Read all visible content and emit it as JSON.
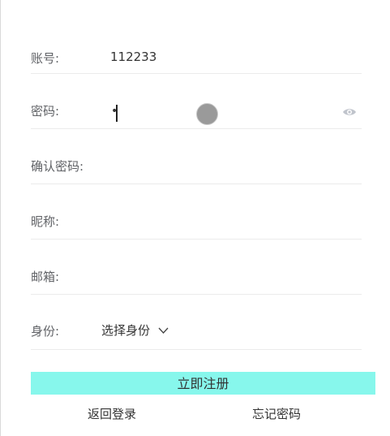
{
  "form": {
    "account": {
      "label": "账号:",
      "value": "112233"
    },
    "password": {
      "label": "密码:",
      "masked_value": "•"
    },
    "confirm_password": {
      "label": "确认密码:"
    },
    "nickname": {
      "label": "昵称:"
    },
    "email": {
      "label": "邮箱:"
    },
    "role": {
      "label": "身份:",
      "selected": "选择身份"
    }
  },
  "actions": {
    "submit_label": "立即注册",
    "back_login_label": "返回登录",
    "forgot_password_label": "忘记密码"
  },
  "colors": {
    "submit_bg": "#87f7ec",
    "divider": "#ebebeb",
    "eye_icon": "#c0c4cc"
  }
}
